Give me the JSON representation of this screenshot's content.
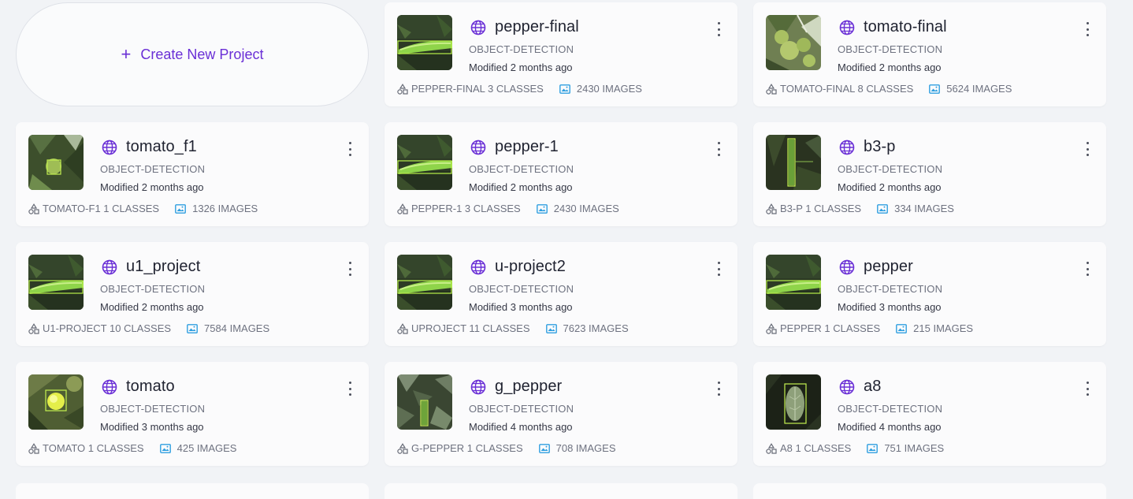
{
  "create_label": "Create New Project",
  "projects": [
    {
      "name": "pepper-final",
      "type": "OBJECT-DETECTION",
      "modified": "Modified 2 months ago",
      "classes": "PEPPER-FINAL 3 CLASSES",
      "images": "2430 IMAGES",
      "thumb": "pepper"
    },
    {
      "name": "tomato-final",
      "type": "OBJECT-DETECTION",
      "modified": "Modified 2 months ago",
      "classes": "TOMATO-FINAL 8 CLASSES",
      "images": "5624 IMAGES",
      "thumb": "tomato-leaves"
    },
    {
      "name": "tomato_f1",
      "type": "OBJECT-DETECTION",
      "modified": "Modified 2 months ago",
      "classes": "TOMATO-F1 1 CLASSES",
      "images": "1326 IMAGES",
      "thumb": "tomato-box"
    },
    {
      "name": "pepper-1",
      "type": "OBJECT-DETECTION",
      "modified": "Modified 2 months ago",
      "classes": "PEPPER-1 3 CLASSES",
      "images": "2430 IMAGES",
      "thumb": "pepper"
    },
    {
      "name": "b3-p",
      "type": "OBJECT-DETECTION",
      "modified": "Modified 2 months ago",
      "classes": "B3-P 1 CLASSES",
      "images": "334 IMAGES",
      "thumb": "dark-stems"
    },
    {
      "name": "u1_project",
      "type": "OBJECT-DETECTION",
      "modified": "Modified 2 months ago",
      "classes": "U1-PROJECT 10 CLASSES",
      "images": "7584 IMAGES",
      "thumb": "pepper"
    },
    {
      "name": "u-project2",
      "type": "OBJECT-DETECTION",
      "modified": "Modified 3 months ago",
      "classes": "UPROJECT 11 CLASSES",
      "images": "7623 IMAGES",
      "thumb": "pepper"
    },
    {
      "name": "pepper",
      "type": "OBJECT-DETECTION",
      "modified": "Modified 3 months ago",
      "classes": "PEPPER 1 CLASSES",
      "images": "215 IMAGES",
      "thumb": "pepper"
    },
    {
      "name": "tomato",
      "type": "OBJECT-DETECTION",
      "modified": "Modified 3 months ago",
      "classes": "TOMATO 1 CLASSES",
      "images": "425 IMAGES",
      "thumb": "tomato-yellow"
    },
    {
      "name": "g_pepper",
      "type": "OBJECT-DETECTION",
      "modified": "Modified 4 months ago",
      "classes": "G-PEPPER 1 CLASSES",
      "images": "708 IMAGES",
      "thumb": "leaves-box"
    },
    {
      "name": "a8",
      "type": "OBJECT-DETECTION",
      "modified": "Modified 4 months ago",
      "classes": "A8 1 CLASSES",
      "images": "751 IMAGES",
      "thumb": "dark-leaf"
    }
  ],
  "icons": {
    "project_type": "globe-icon",
    "menu": "kebab-menu-icon",
    "classes": "classes-shapes-icon",
    "images": "image-icon"
  },
  "colors": {
    "accent": "#6a2fd6",
    "image_icon": "#2f9fe0",
    "background": "#f1f3f6",
    "card": "#fbfbfc"
  }
}
